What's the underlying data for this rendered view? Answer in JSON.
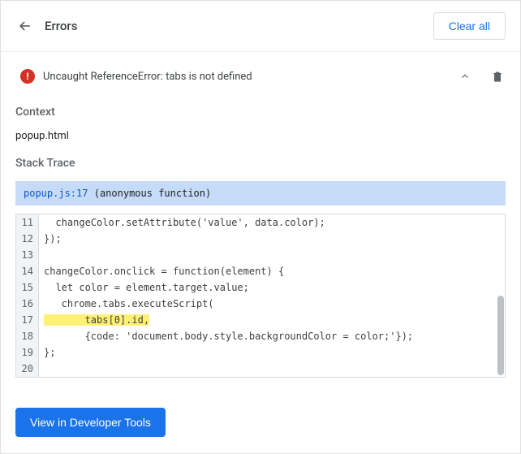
{
  "header": {
    "title": "Errors",
    "clear_label": "Clear all"
  },
  "error": {
    "message": "Uncaught ReferenceError: tabs is not defined"
  },
  "context": {
    "label": "Context",
    "value": "popup.html"
  },
  "stack": {
    "label": "Stack Trace",
    "location": "popup.js:17",
    "func": "(anonymous function)"
  },
  "code": {
    "lines": [
      {
        "n": 11,
        "t": "  changeColor.setAttribute('value', data.color);",
        "hl": false
      },
      {
        "n": 12,
        "t": "});",
        "hl": false
      },
      {
        "n": 13,
        "t": "",
        "hl": false
      },
      {
        "n": 14,
        "t": "changeColor.onclick = function(element) {",
        "hl": false
      },
      {
        "n": 15,
        "t": "  let color = element.target.value;",
        "hl": false
      },
      {
        "n": 16,
        "t": "   chrome.tabs.executeScript(",
        "hl": false
      },
      {
        "n": 17,
        "t": "       tabs[0].id,",
        "hl": true
      },
      {
        "n": 18,
        "t": "       {code: 'document.body.style.backgroundColor = color;'});",
        "hl": false
      },
      {
        "n": 19,
        "t": "};",
        "hl": false
      },
      {
        "n": 20,
        "t": "",
        "hl": false
      }
    ]
  },
  "footer": {
    "dev_label": "View in Developer Tools"
  }
}
